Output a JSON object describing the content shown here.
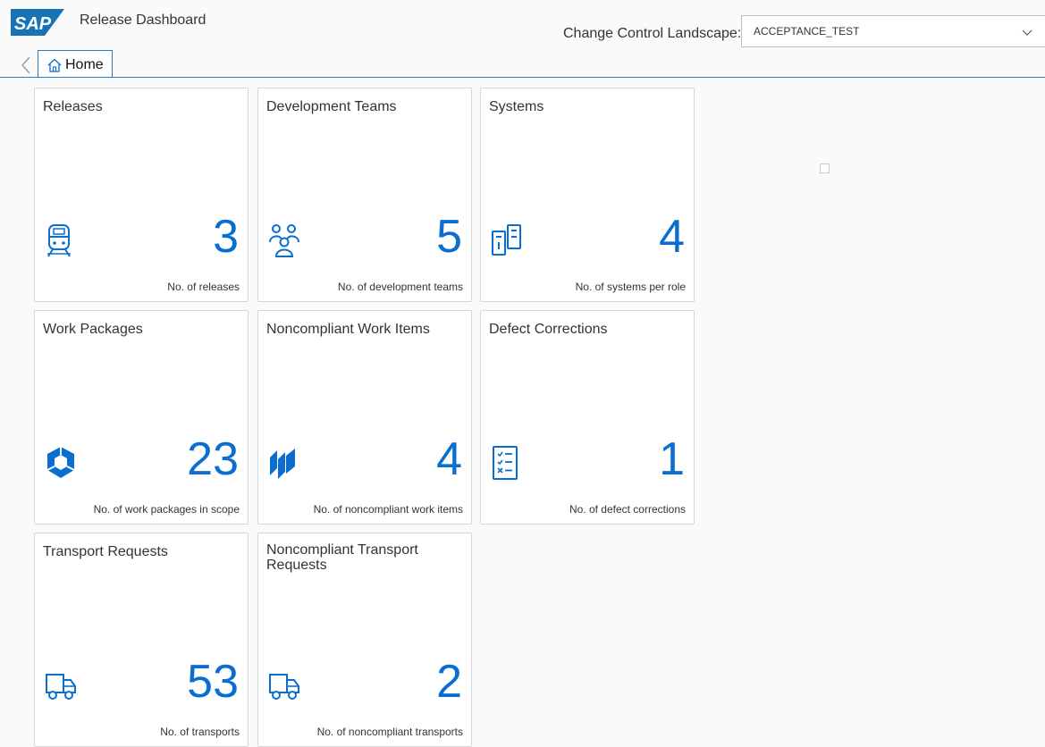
{
  "header": {
    "logo_text": "SAP",
    "app_title": "Release Dashboard",
    "landscape_label": "Change Control Landscape:",
    "landscape_value": "ACCEPTANCE_TEST",
    "icons": {
      "back": "chevron-left-icon",
      "dropdown": "chevron-down-icon",
      "home": "home-icon"
    }
  },
  "tabs": [
    {
      "label": "Home",
      "icon": "home-icon"
    }
  ],
  "colors": {
    "accent": "#0a6ed1",
    "tab_border": "#2b7cc2",
    "brand": "#1873b4"
  },
  "tiles": [
    {
      "title": "Releases",
      "value": "3",
      "footer": "No. of releases",
      "icon": "train-icon"
    },
    {
      "title": "Development Teams",
      "value": "5",
      "footer": "No. of development teams",
      "icon": "group-icon"
    },
    {
      "title": "Systems",
      "value": "4",
      "footer": "No. of systems per role",
      "icon": "systems-icon"
    },
    {
      "title": "Work Packages",
      "value": "23",
      "footer": "No. of work packages in scope",
      "icon": "cube-icon"
    },
    {
      "title": "Noncompliant Work Items",
      "value": "4",
      "footer": "No. of noncompliant work items",
      "icon": "stacked-panels-icon"
    },
    {
      "title": "Defect Corrections",
      "value": "1",
      "footer": "No. of defect corrections",
      "icon": "checklist-icon"
    },
    {
      "title": "Transport Requests",
      "value": "53",
      "footer": "No. of transports",
      "icon": "truck-icon"
    },
    {
      "title": "Noncompliant Transport Requests",
      "value": "2",
      "footer": "No. of noncompliant transports",
      "icon": "truck-icon"
    }
  ]
}
